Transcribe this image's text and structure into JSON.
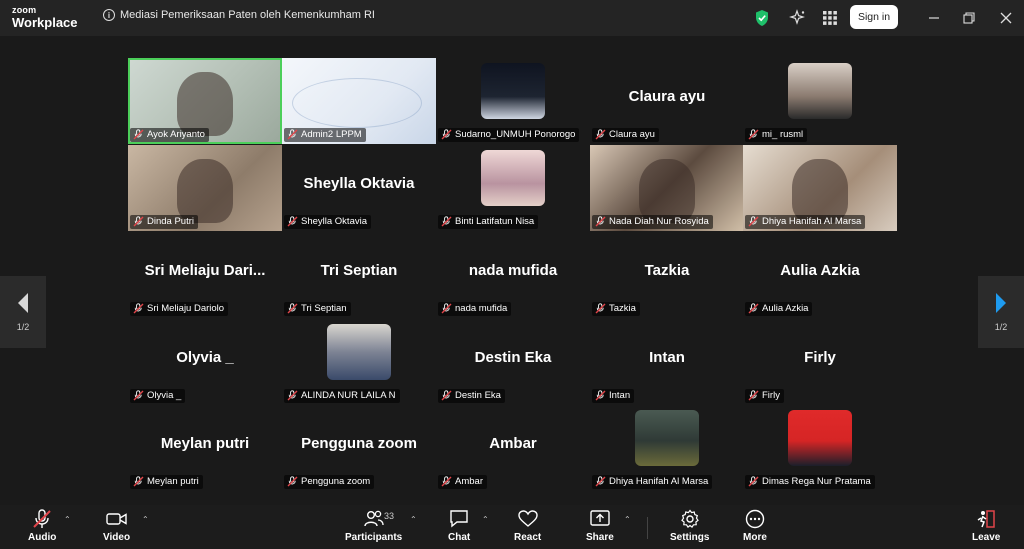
{
  "app": {
    "brand_top": "zoom",
    "brand_bottom": "Workplace"
  },
  "meeting": {
    "title": "Mediasi Pemeriksaan Paten oleh Kemenkumham RI"
  },
  "header": {
    "signin_label": "Sign in"
  },
  "pager": {
    "left_label": "1/2",
    "right_label": "1/2"
  },
  "participants": [
    {
      "display": "",
      "tag": "Ayok Ariyanto",
      "kind": "video",
      "active": true
    },
    {
      "display": "",
      "tag": "Admin2 LPPM",
      "kind": "slide"
    },
    {
      "display": "",
      "tag": "Sudarno_UNMUH Ponorogo",
      "kind": "avatar"
    },
    {
      "display": "Claura ayu",
      "tag": "Claura ayu",
      "kind": "name"
    },
    {
      "display": "",
      "tag": "mi_ rusml",
      "kind": "avatar"
    },
    {
      "display": "",
      "tag": "Dinda Putri",
      "kind": "video"
    },
    {
      "display": "Sheylla Oktavia",
      "tag": "Sheylla Oktavia",
      "kind": "name"
    },
    {
      "display": "",
      "tag": "Binti Latifatun Nisa",
      "kind": "avatar"
    },
    {
      "display": "",
      "tag": "Nada Diah Nur Rosyida",
      "kind": "video"
    },
    {
      "display": "",
      "tag": "Dhiya Hanifah Al Marsa",
      "kind": "video"
    },
    {
      "display": "Sri Meliaju Dari...",
      "tag": "Sri Meliaju Dariolo",
      "kind": "name"
    },
    {
      "display": "Tri Septian",
      "tag": "Tri Septian",
      "kind": "name"
    },
    {
      "display": "nada mufida",
      "tag": "nada mufida",
      "kind": "name"
    },
    {
      "display": "Tazkia",
      "tag": "Tazkia",
      "kind": "name"
    },
    {
      "display": "Aulia Azkia",
      "tag": "Aulia Azkia",
      "kind": "name"
    },
    {
      "display": "Olyvia _",
      "tag": "Olyvia _",
      "kind": "name"
    },
    {
      "display": "",
      "tag": "ALINDA NUR LAILA N",
      "kind": "avatar"
    },
    {
      "display": "Destin Eka",
      "tag": "Destin Eka",
      "kind": "name"
    },
    {
      "display": "Intan",
      "tag": "Intan",
      "kind": "name"
    },
    {
      "display": "Firly",
      "tag": "Firly",
      "kind": "name"
    },
    {
      "display": "Meylan putri",
      "tag": "Meylan putri",
      "kind": "name"
    },
    {
      "display": "Pengguna zoom",
      "tag": "Pengguna zoom",
      "kind": "name"
    },
    {
      "display": "Ambar",
      "tag": "Ambar",
      "kind": "name"
    },
    {
      "display": "",
      "tag": "Dhiya Hanifah Al Marsa",
      "kind": "avatar"
    },
    {
      "display": "",
      "tag": "Dimas Rega Nur Pratama",
      "kind": "avatar"
    }
  ],
  "toolbar": {
    "audio": "Audio",
    "video": "Video",
    "participants": "Participants",
    "participants_count": "33",
    "chat": "Chat",
    "react": "React",
    "share": "Share",
    "settings": "Settings",
    "more": "More",
    "leave": "Leave"
  },
  "colors": {
    "accent": "#1e9bf0",
    "active_speaker": "#4ccf5a",
    "muted": "#e0454a",
    "shield": "#1fc06a"
  }
}
